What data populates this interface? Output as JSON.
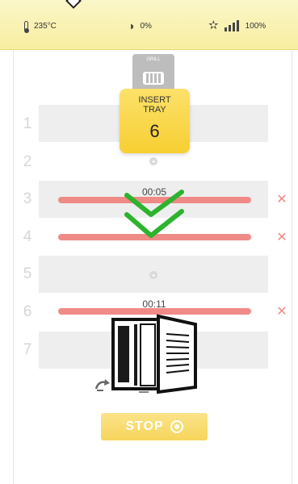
{
  "status_bar": {
    "temperature": "235°C",
    "humidity": "0%",
    "fan_power": "100%",
    "icons": [
      "thermometer-icon",
      "water-drop-icon",
      "fan-icon",
      "signal-bars-icon"
    ]
  },
  "grill_chip": {
    "label": "GRILL"
  },
  "insert_prompt": {
    "title": "INSERT\nTRAY",
    "tray_number": "6"
  },
  "trays": [
    {
      "number": "1",
      "state": "empty"
    },
    {
      "number": "2",
      "state": "add"
    },
    {
      "number": "3",
      "state": "running",
      "time": "00:05"
    },
    {
      "number": "4",
      "state": "running",
      "time": ""
    },
    {
      "number": "5",
      "state": "add"
    },
    {
      "number": "6",
      "state": "running",
      "time": "00:11"
    },
    {
      "number": "7",
      "state": "empty"
    }
  ],
  "remove_icon": "✕",
  "stop_button": {
    "label": "STOP"
  },
  "colors": {
    "header_bg": "#f7eea0",
    "accent_yellow": "#f7cf32",
    "timer_bar": "#ef8a86",
    "check_green": "#2db32d"
  }
}
